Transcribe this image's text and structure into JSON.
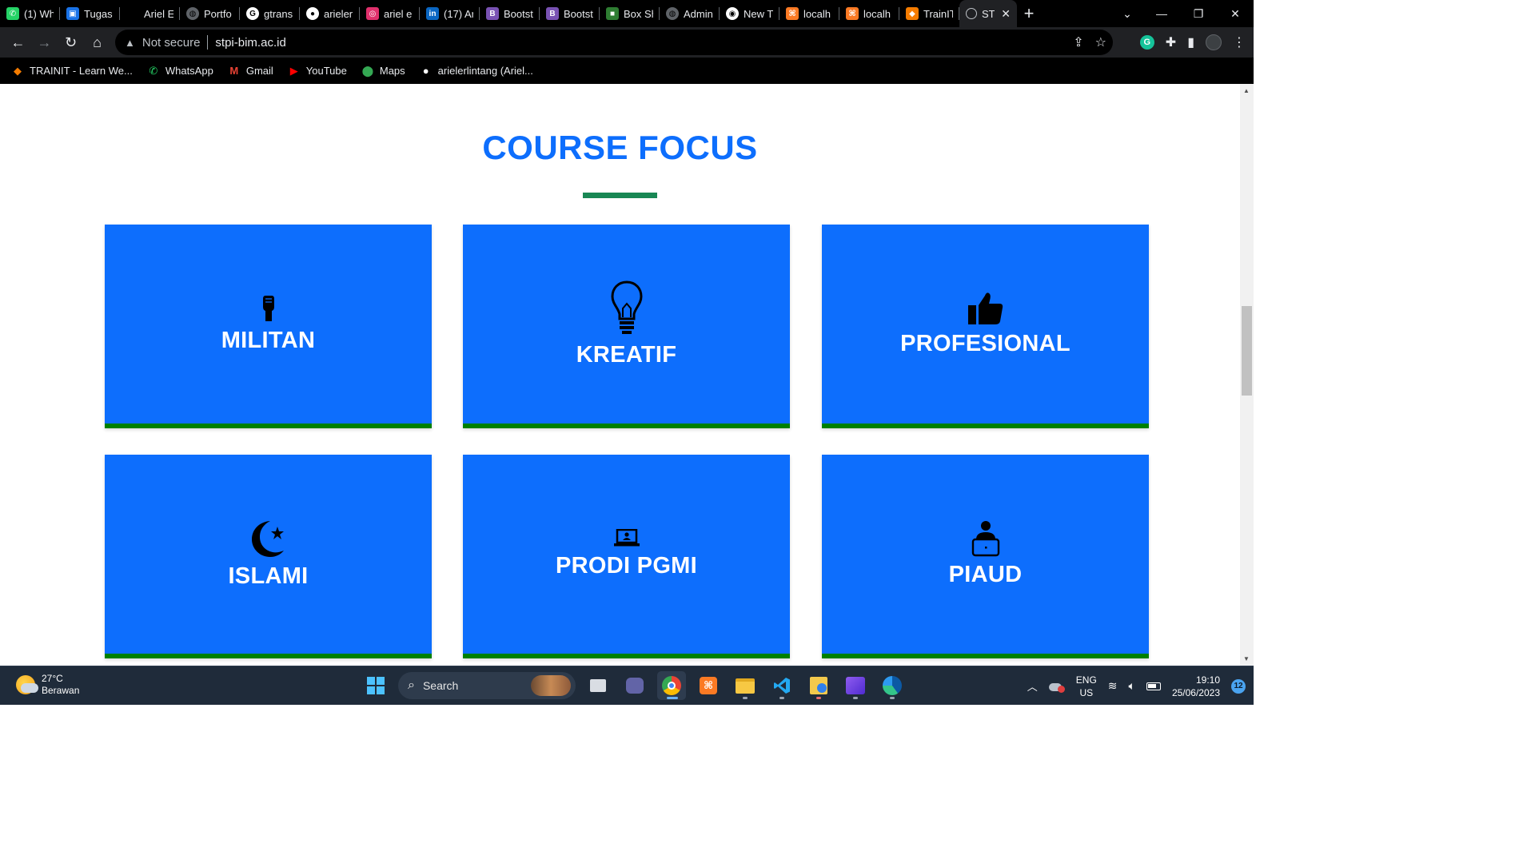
{
  "browser": {
    "tabs": [
      {
        "label": "(1) Wh",
        "icon": "whatsapp-icon",
        "color": "#25d366"
      },
      {
        "label": "Tugas",
        "icon": "classroom-icon",
        "color": "#1a73e8"
      },
      {
        "label": "Ariel E",
        "icon": "blank-icon",
        "color": "#000000"
      },
      {
        "label": "Portfo",
        "icon": "globe-icon",
        "color": "#5f6368"
      },
      {
        "label": "gtrans",
        "icon": "google-icon",
        "color": "#ffffff"
      },
      {
        "label": "arieler",
        "icon": "github-icon",
        "color": "#ffffff"
      },
      {
        "label": "ariel e",
        "icon": "instagram-icon",
        "color": "#e1306c"
      },
      {
        "label": "(17) Ar",
        "icon": "linkedin-icon",
        "color": "#0a66c2"
      },
      {
        "label": "Bootst",
        "icon": "bootstrap-icon",
        "color": "#7952b3"
      },
      {
        "label": "Bootst",
        "icon": "bootstrap-icon",
        "color": "#7952b3"
      },
      {
        "label": "Box Sh",
        "icon": "box-shadow-icon",
        "color": "#2e7d32"
      },
      {
        "label": "Admin",
        "icon": "globe-icon",
        "color": "#5f6368"
      },
      {
        "label": "New T",
        "icon": "chrome-icon",
        "color": "#ffffff"
      },
      {
        "label": "localh",
        "icon": "xampp-icon",
        "color": "#fb7a24"
      },
      {
        "label": "localh",
        "icon": "xampp-icon",
        "color": "#fb7a24"
      },
      {
        "label": "TrainIT",
        "icon": "trainit-icon",
        "color": "#f57c00"
      }
    ],
    "active_tab": {
      "label": "STI",
      "icon": "globe-icon"
    },
    "new_tab": "+",
    "address": {
      "security": "Not secure",
      "url": "stpi-bim.ac.id"
    },
    "bookmarks": [
      {
        "label": "TRAINIT - Learn We...",
        "icon": "trainit-icon"
      },
      {
        "label": "WhatsApp",
        "icon": "whatsapp-icon"
      },
      {
        "label": "Gmail",
        "icon": "gmail-icon"
      },
      {
        "label": "YouTube",
        "icon": "youtube-icon"
      },
      {
        "label": "Maps",
        "icon": "maps-icon"
      },
      {
        "label": "arielerlintang (Ariel...",
        "icon": "github-icon"
      }
    ],
    "extension_letter": "G"
  },
  "page": {
    "heading": "COURSE FOCUS",
    "accent_color": "#0d6efd",
    "underline_color": "#198754",
    "card_border_color": "#008000",
    "cards": [
      {
        "label": "MILITAN",
        "icon": "fist-icon"
      },
      {
        "label": "KREATIF",
        "icon": "lightbulb-icon"
      },
      {
        "label": "PROFESIONAL",
        "icon": "thumbs-up-icon"
      },
      {
        "label": "ISLAMI",
        "icon": "crescent-star-icon"
      },
      {
        "label": "PRODI PGMI",
        "icon": "laptop-user-icon"
      },
      {
        "label": "PIAUD",
        "icon": "user-laptop-icon"
      }
    ]
  },
  "taskbar": {
    "weather": {
      "temp": "27°C",
      "desc": "Berawan"
    },
    "search_label": "Search",
    "lang": {
      "line1": "ENG",
      "line2": "US"
    },
    "clock": {
      "time": "19:10",
      "date": "25/06/2023"
    },
    "notifications": "12"
  }
}
